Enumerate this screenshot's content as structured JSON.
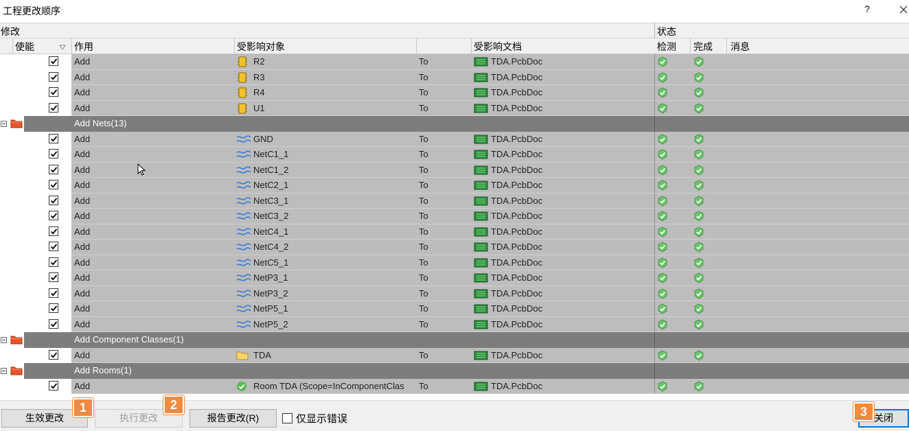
{
  "window": {
    "title": "工程更改顺序",
    "help": "?"
  },
  "headers": {
    "modify": "修改",
    "status": "状态",
    "enable": "使能",
    "action": "作用",
    "affected_object": "受影响对象",
    "affected_document": "受影响文档",
    "check": "检测",
    "done": "完成",
    "message": "消息"
  },
  "rows": [
    {
      "type": "item",
      "action": "Add",
      "object": "R2",
      "icon": "component-icon",
      "to": "To",
      "doc": "TDA.PcbDoc",
      "checked": true
    },
    {
      "type": "item",
      "action": "Add",
      "object": "R3",
      "icon": "component-icon",
      "to": "To",
      "doc": "TDA.PcbDoc",
      "checked": true
    },
    {
      "type": "item",
      "action": "Add",
      "object": "R4",
      "icon": "component-icon",
      "to": "To",
      "doc": "TDA.PcbDoc",
      "checked": true
    },
    {
      "type": "item",
      "action": "Add",
      "object": "U1",
      "icon": "component-icon",
      "to": "To",
      "doc": "TDA.PcbDoc",
      "checked": true
    },
    {
      "type": "group",
      "label": "Add Nets(13)"
    },
    {
      "type": "item",
      "action": "Add",
      "object": "GND",
      "icon": "net-icon",
      "to": "To",
      "doc": "TDA.PcbDoc",
      "checked": true
    },
    {
      "type": "item",
      "action": "Add",
      "object": "NetC1_1",
      "icon": "net-icon",
      "to": "To",
      "doc": "TDA.PcbDoc",
      "checked": true
    },
    {
      "type": "item",
      "action": "Add",
      "object": "NetC1_2",
      "icon": "net-icon",
      "to": "To",
      "doc": "TDA.PcbDoc",
      "checked": true
    },
    {
      "type": "item",
      "action": "Add",
      "object": "NetC2_1",
      "icon": "net-icon",
      "to": "To",
      "doc": "TDA.PcbDoc",
      "checked": true
    },
    {
      "type": "item",
      "action": "Add",
      "object": "NetC3_1",
      "icon": "net-icon",
      "to": "To",
      "doc": "TDA.PcbDoc",
      "checked": true
    },
    {
      "type": "item",
      "action": "Add",
      "object": "NetC3_2",
      "icon": "net-icon",
      "to": "To",
      "doc": "TDA.PcbDoc",
      "checked": true
    },
    {
      "type": "item",
      "action": "Add",
      "object": "NetC4_1",
      "icon": "net-icon",
      "to": "To",
      "doc": "TDA.PcbDoc",
      "checked": true
    },
    {
      "type": "item",
      "action": "Add",
      "object": "NetC4_2",
      "icon": "net-icon",
      "to": "To",
      "doc": "TDA.PcbDoc",
      "checked": true
    },
    {
      "type": "item",
      "action": "Add",
      "object": "NetC5_1",
      "icon": "net-icon",
      "to": "To",
      "doc": "TDA.PcbDoc",
      "checked": true
    },
    {
      "type": "item",
      "action": "Add",
      "object": "NetP3_1",
      "icon": "net-icon",
      "to": "To",
      "doc": "TDA.PcbDoc",
      "checked": true
    },
    {
      "type": "item",
      "action": "Add",
      "object": "NetP3_2",
      "icon": "net-icon",
      "to": "To",
      "doc": "TDA.PcbDoc",
      "checked": true
    },
    {
      "type": "item",
      "action": "Add",
      "object": "NetP5_1",
      "icon": "net-icon",
      "to": "To",
      "doc": "TDA.PcbDoc",
      "checked": true
    },
    {
      "type": "item",
      "action": "Add",
      "object": "NetP5_2",
      "icon": "net-icon",
      "to": "To",
      "doc": "TDA.PcbDoc",
      "checked": true
    },
    {
      "type": "group",
      "label": "Add Component Classes(1)"
    },
    {
      "type": "item",
      "action": "Add",
      "object": "TDA",
      "icon": "folder-icon",
      "to": "To",
      "doc": "TDA.PcbDoc",
      "checked": true
    },
    {
      "type": "group",
      "label": "Add Rooms(1)"
    },
    {
      "type": "item",
      "action": "Add",
      "object": "Room TDA (Scope=InComponentClas",
      "icon": "room-check-icon",
      "to": "To",
      "doc": "TDA.PcbDoc",
      "checked": true
    }
  ],
  "buttons": {
    "validate": "生效更改",
    "execute": "执行更改",
    "report_main": "报告更改(R)",
    "report_suffix": "(R)...",
    "close": "关闭"
  },
  "only_errors_label": "仅显示错误",
  "badges": [
    "1",
    "2",
    "3"
  ],
  "colors": {
    "row_gray": "#bdbdbd",
    "group_band": "#7d7d7d",
    "check_green": "#4caf50",
    "badge_orange": "#f5893c",
    "primary_border": "#0078d7"
  }
}
